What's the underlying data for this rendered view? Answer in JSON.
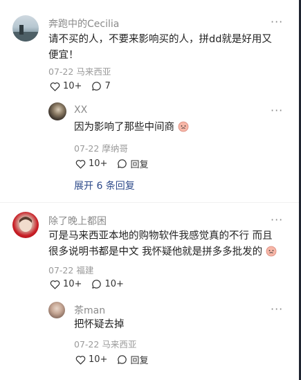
{
  "comments": [
    {
      "username": "奔跑中的Cecilia",
      "more": "···",
      "text": "请不买的人，不要来影响买的人，拼dd就是好用又便宜！",
      "date": "07-22",
      "location": "马来西亚",
      "likes": "10+",
      "replies_count": "7",
      "reply": {
        "username": "XX",
        "more": "···",
        "text": "因为影响了那些中间商",
        "date": "07-22",
        "location": "摩纳哥",
        "likes": "10+",
        "reply_label": "回复"
      },
      "expand_label": "展开 6 条回复"
    },
    {
      "username": "除了晚上都困",
      "more": "···",
      "text": "可是马来西亚本地的购物软件我感觉真的不行 而且很多说明书都是中文 我怀疑他就是拼多多批发的",
      "date": "07-22",
      "location": "福建",
      "likes": "10+",
      "replies_count": "10+",
      "reply": {
        "username": "茶man",
        "more": "···",
        "text": "把怀疑去掉",
        "date": "07-22",
        "location": "马来西亚",
        "likes": "10+",
        "reply_label": "回复"
      }
    }
  ],
  "colors": {
    "link": "#2d4a8a",
    "muted": "#9a9a9a",
    "username": "#8a8a8a"
  },
  "icons": [
    "heart-icon",
    "comment-icon",
    "emoji-face-icon",
    "more-icon"
  ]
}
